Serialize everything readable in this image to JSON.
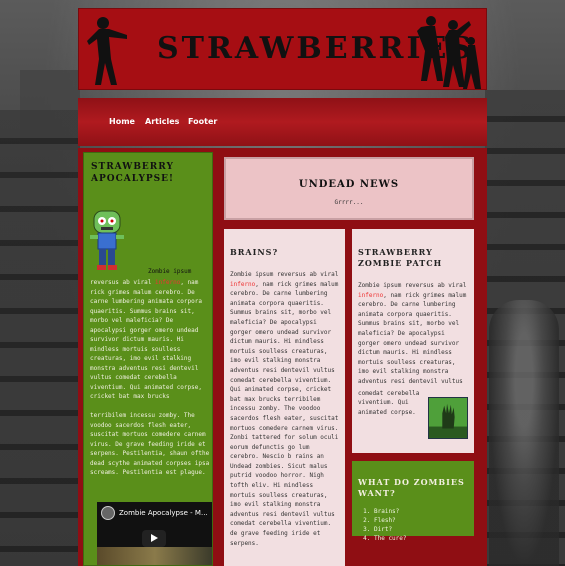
{
  "header": {
    "title": "STRAWBERRIES"
  },
  "nav": {
    "items": [
      "Home",
      "Articles",
      "Footer"
    ]
  },
  "sidebar": {
    "title": "STRAWBERRY APOCALYPSE!",
    "image_caption": "Zombie ipsum",
    "p1_start": "reversus ab viral ",
    "p1_hl": "inferno",
    "p1_end": ", nam rick grimes malum cerebro. De carne lumbering animata corpora quaeritis. Summus brains sit, morbo vel maleficia? De apocalypsi gorger omero undead survivor dictum mauris. Hi mindless mortuis soulless creaturas, imo evil stalking monstra adventus resi dentevil vultus comedat cerebella viventium. Qui animated corpse, cricket bat max brucks",
    "p2": "terribilem incessu zomby. The voodoo sacerdos flesh eater, suscitat mortuos comedere carnem virus. De grave feeding iride et serpens. Pestilentia, shaun ofthe dead scythe animated corpses ipsa screams. Pestilentia est plague.",
    "video_title": "Zombie Apocalypse - M..."
  },
  "news": {
    "title": "UNDEAD NEWS",
    "subtitle": "Grrrr..."
  },
  "brains": {
    "title": "BRAINS?",
    "p1_start": "Zombie ipsum reversus ab viral ",
    "p1_hl": "inferno",
    "p1_end": ", nam rick grimes malum cerebro. De carne lumbering animata corpora quaeritis. Summus brains sit, morbo vel maleficia? De apocalypsi gorger omero undead survivor dictum mauris. Hi mindless mortuis soulless creaturas, imo evil stalking monstra adventus resi dentevil vultus comedat cerebella viventium. Qui animated corpse, cricket bat max brucks terribilem incessu zomby. The voodoo sacerdos flesh eater, suscitat mortuos comedere carnem virus. Zonbi tattered for solum oculi eorum defunctis go lum cerebro. Nescio b rains an Undead zombies. Sicut malus putrid voodoo horror. Nigh tofth eliv. Hi mindless mortuis soulless creaturas, imo evil stalking monstra adventus resi dentevil vultus comedat cerebella viventium. de grave feeding iride et serpens."
  },
  "patch": {
    "title": "STRAWBERRY ZOMBIE PATCH",
    "p1_start": "Zombie ipsum reversus ab viral ",
    "p1_hl": "inferno",
    "p1_end": ", nam rick grimes malum cerebro. De carne lumbering animata corpora quaeritis. Summus brains sit, morbo vel maleficia? De apocalypsi gorger omero undead survivor dictum mauris. Hi mindless mortuis soulless creaturas, imo evil stalking monstra adventus resi dentevil vultus",
    "p2": "comedat cerebella viventium. Qui animated corpse."
  },
  "questions": {
    "title": "WHAT DO ZOMBIES WANT?",
    "items": [
      "Brains?",
      "Flesh?",
      "Dirt?",
      "The cure?"
    ]
  },
  "colors": {
    "header_red": "#a60e13",
    "sidebar_green": "#5a8f1a",
    "panel_pink": "#f2dfe1",
    "highlight": "#e33333"
  }
}
